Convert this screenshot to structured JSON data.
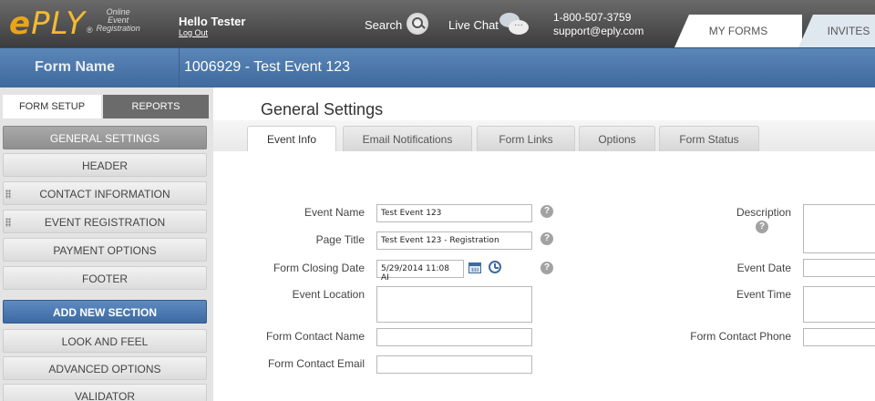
{
  "topbar": {
    "logo_text_e": "e",
    "logo_text_rest": "PLY",
    "logo_reg": "®",
    "logo_tagline": [
      "Online",
      "Event",
      "Registration"
    ],
    "greeting": "Hello Tester",
    "logout": "Log Out",
    "search_label": "Search",
    "chat_label": "Live Chat",
    "phone": "1-800-507-3759",
    "email": "support@eply.com",
    "tabs": [
      "MY FORMS",
      "INVITES"
    ]
  },
  "header": {
    "form_name_label": "Form Name",
    "form_title": "1006929 - Test Event 123"
  },
  "sidebar": {
    "tabs": [
      "FORM SETUP",
      "REPORTS"
    ],
    "items": [
      "GENERAL SETTINGS",
      "HEADER",
      "CONTACT INFORMATION",
      "EVENT REGISTRATION",
      "PAYMENT OPTIONS",
      "FOOTER",
      "ADD NEW SECTION",
      "LOOK AND FEEL",
      "ADVANCED OPTIONS",
      "VALIDATOR"
    ]
  },
  "main": {
    "title": "General Settings",
    "tabs": [
      "Event Info",
      "Email Notifications",
      "Form Links",
      "Options",
      "Form Status"
    ],
    "fields": {
      "event_name_label": "Event Name",
      "event_name_value": "Test Event 123",
      "page_title_label": "Page Title",
      "page_title_value": "Test Event 123 - Registration",
      "closing_date_label": "Form Closing Date",
      "closing_date_value": "5/29/2014 11:08 AI",
      "event_location_label": "Event Location",
      "contact_name_label": "Form Contact Name",
      "contact_email_label": "Form Contact Email",
      "description_label": "Description",
      "event_date_label": "Event Date",
      "event_time_label": "Event Time",
      "contact_phone_label": "Form Contact Phone"
    },
    "help_glyph": "?"
  },
  "colors": {
    "brand_orange": "#e8a51a",
    "header_blue": "#3f6a9e",
    "selected_gray": "#8f8f8f"
  }
}
